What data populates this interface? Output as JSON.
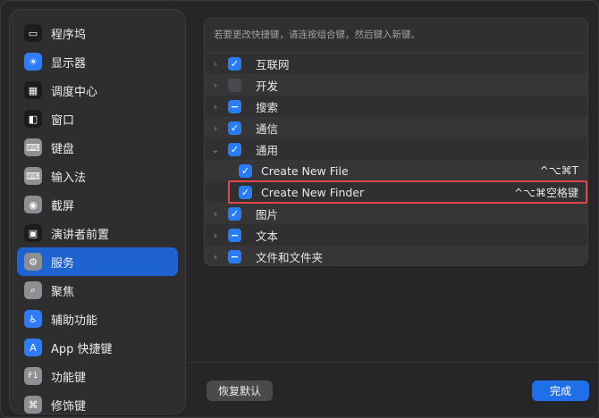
{
  "sidebar": {
    "items": [
      {
        "label": "程序坞",
        "icon": "dock-icon",
        "glyph": "▭",
        "color": "#1c1c1e",
        "active": false
      },
      {
        "label": "显示器",
        "icon": "display-brightness-icon",
        "glyph": "☀",
        "color": "#2f7cf6",
        "active": false
      },
      {
        "label": "调度中心",
        "icon": "mission-control-icon",
        "glyph": "▦",
        "color": "#1c1c1e",
        "active": false
      },
      {
        "label": "窗口",
        "icon": "window-icon",
        "glyph": "◧",
        "color": "#1c1c1e",
        "active": false
      },
      {
        "label": "键盘",
        "icon": "keyboard-icon",
        "glyph": "⌨",
        "color": "#8e8e93",
        "active": false
      },
      {
        "label": "输入法",
        "icon": "input-method-icon",
        "glyph": "⌨",
        "color": "#8e8e93",
        "active": false
      },
      {
        "label": "截屏",
        "icon": "screenshot-camera-icon",
        "glyph": "◉",
        "color": "#8e8e93",
        "active": false
      },
      {
        "label": "演讲者前置",
        "icon": "presenter-icon",
        "glyph": "▣",
        "color": "#1c1c1e",
        "active": false
      },
      {
        "label": "服务",
        "icon": "services-gear-icon",
        "glyph": "⚙",
        "color": "#8e8e93",
        "active": true
      },
      {
        "label": "聚焦",
        "icon": "spotlight-search-icon",
        "glyph": "⌕",
        "color": "#8e8e93",
        "active": false
      },
      {
        "label": "辅助功能",
        "icon": "accessibility-icon",
        "glyph": "♿",
        "color": "#2f7cf6",
        "active": false
      },
      {
        "label": "App 快捷键",
        "icon": "app-store-icon",
        "glyph": "A",
        "color": "#2f7cf6",
        "active": false
      },
      {
        "label": "功能键",
        "icon": "function-key-icon",
        "glyph": "F1",
        "color": "#8e8e93",
        "active": false
      },
      {
        "label": "修饰键",
        "icon": "command-key-icon",
        "glyph": "⌘",
        "color": "#8e8e93",
        "active": false
      }
    ]
  },
  "main": {
    "hint": "若要更改快捷键，请连按组合键，然后键入新键。",
    "rows": [
      {
        "label": "互联网",
        "state": "on",
        "chevron": "›"
      },
      {
        "label": "开发",
        "state": "off",
        "chevron": "›"
      },
      {
        "label": "搜索",
        "state": "mixed",
        "chevron": "›"
      },
      {
        "label": "通信",
        "state": "on",
        "chevron": "›"
      },
      {
        "label": "通用",
        "state": "on",
        "chevron": "⌄"
      }
    ],
    "subrows": [
      {
        "label": "Create New File",
        "shortcut": "^⌥⌘T"
      },
      {
        "label": "Create New Finder",
        "shortcut": "^⌥⌘空格键"
      }
    ],
    "rows_after": [
      {
        "label": "图片",
        "state": "on",
        "chevron": "›"
      },
      {
        "label": "文本",
        "state": "mixed",
        "chevron": "›"
      },
      {
        "label": "文件和文件夹",
        "state": "mixed",
        "chevron": "›"
      }
    ]
  },
  "footer": {
    "restore_label": "恢复默认",
    "done_label": "完成"
  },
  "colors": {
    "accent": "#2a7cf5",
    "highlight_border": "#e0474a",
    "sidebar_active": "#1f63d0"
  }
}
